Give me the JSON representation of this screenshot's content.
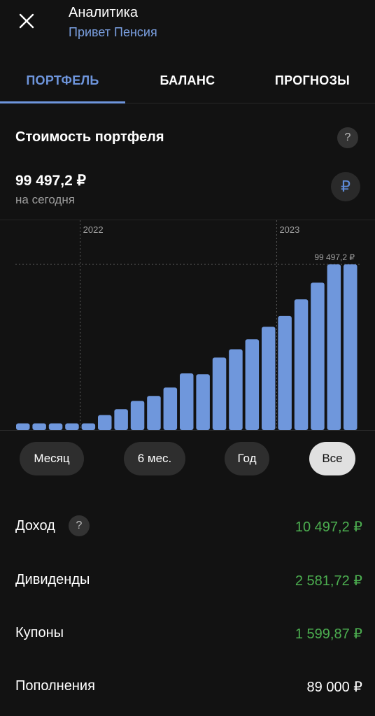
{
  "header": {
    "title": "Аналитика",
    "subtitle": "Привет Пенсия"
  },
  "tabs": [
    {
      "label": "ПОРТФЕЛЬ",
      "active": true
    },
    {
      "label": "БАЛАНС",
      "active": false
    },
    {
      "label": "ПРОГНОЗЫ",
      "active": false
    }
  ],
  "portfolio": {
    "title": "Стоимость портфеля",
    "help_glyph": "?",
    "value": "99 497,2  ₽",
    "date_label": "на сегодня",
    "currency_glyph": "₽"
  },
  "chart_data": {
    "type": "bar",
    "year_markers": [
      {
        "label": "2022",
        "bar_index": 3.5
      },
      {
        "label": "2023",
        "bar_index": 15.5
      }
    ],
    "max_label": "99 497,2 ₽",
    "values": [
      4000,
      4000,
      4000,
      4000,
      4000,
      9000,
      12500,
      17500,
      20500,
      25500,
      34000,
      33500,
      43500,
      48500,
      54500,
      62000,
      68500,
      78500,
      88500,
      99497.2,
      99497.2
    ],
    "ylim": [
      0,
      105000
    ],
    "color": "#6f97dc",
    "grid": false
  },
  "periods": [
    {
      "label": "Месяц",
      "active": false
    },
    {
      "label": "6 мес.",
      "active": false
    },
    {
      "label": "Год",
      "active": false
    },
    {
      "label": "Все",
      "active": true
    }
  ],
  "stats": {
    "income": {
      "label": "Доход",
      "value": "10 497,2 ₽",
      "help_glyph": "?"
    },
    "dividends": {
      "label": "Дивиденды",
      "value": "2 581,72 ₽"
    },
    "coupons": {
      "label": "Купоны",
      "value": "1 599,87 ₽"
    },
    "deposits": {
      "label": "Пополнения",
      "value": "89 000 ₽"
    }
  },
  "colors": {
    "accent": "#6e95dc",
    "positive": "#4caf50",
    "background": "#121212"
  }
}
